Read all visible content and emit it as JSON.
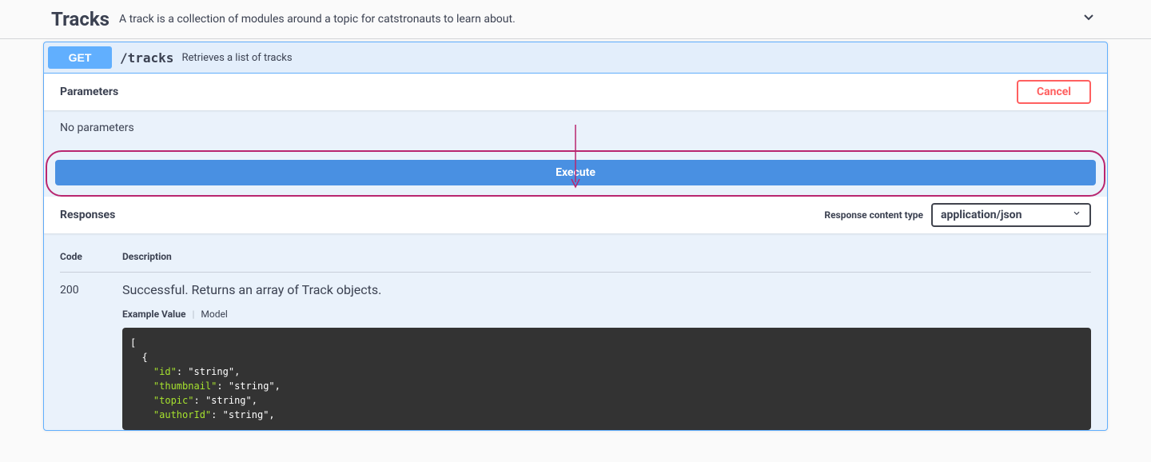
{
  "tag": {
    "name": "Tracks",
    "description": "A track is a collection of modules around a topic for catstronauts to learn about."
  },
  "operation": {
    "method": "GET",
    "path": "/tracks",
    "summary": "Retrieves a list of tracks"
  },
  "parameters": {
    "section_title": "Parameters",
    "cancel_label": "Cancel",
    "empty_text": "No parameters"
  },
  "execute": {
    "label": "Execute"
  },
  "responses": {
    "section_title": "Responses",
    "content_type_label": "Response content type",
    "content_type_value": "application/json",
    "columns": {
      "code": "Code",
      "description": "Description"
    },
    "rows": [
      {
        "code": "200",
        "description": "Successful. Returns an array of Track objects.",
        "tabs": {
          "example": "Example Value",
          "model": "Model"
        },
        "example_lines": [
          "[",
          "  {",
          "    \"id\": \"string\",",
          "    \"thumbnail\": \"string\",",
          "    \"topic\": \"string\",",
          "    \"authorId\": \"string\","
        ]
      }
    ]
  }
}
